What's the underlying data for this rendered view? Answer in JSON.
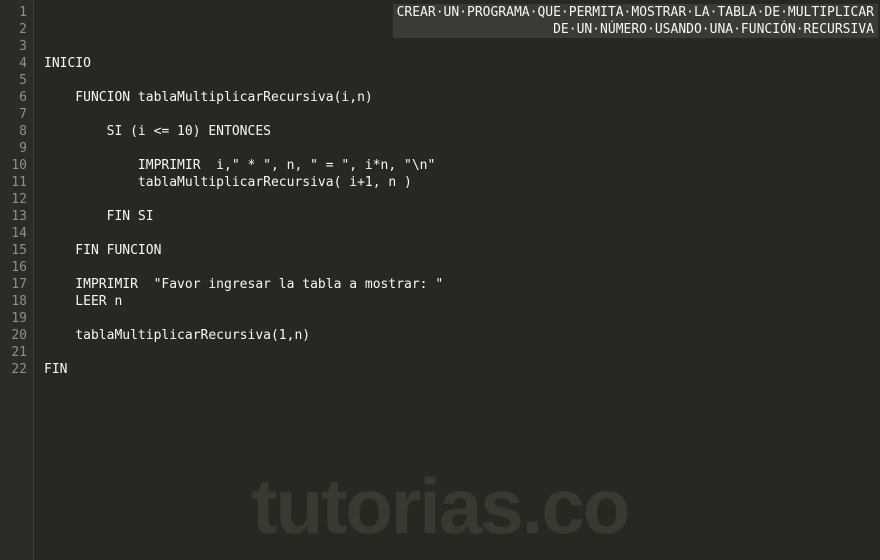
{
  "editor": {
    "gutter_start": 1,
    "gutter_end": 22,
    "header_lines": [
      "CREAR UN PROGRAMA QUE PERMITA MOSTRAR LA TABLA DE MULTIPLICAR",
      "DE UN NÚMERO USANDO UNA FUNCIÓN RECURSIVA"
    ],
    "lines": {
      "3": "",
      "4": "INICIO",
      "5": "",
      "6": "    FUNCION tablaMultiplicarRecursiva(i,n)",
      "7": "",
      "8": "        SI (i <= 10) ENTONCES",
      "9": "",
      "10": "            IMPRIMIR  i,\" * \", n, \" = \", i*n, \"\\n\"",
      "11": "            tablaMultiplicarRecursiva( i+1, n )",
      "12": "",
      "13": "        FIN SI",
      "14": "",
      "15": "    FIN FUNCION",
      "16": "",
      "17": "    IMPRIMIR  \"Favor ingresar la tabla a mostrar: \"",
      "18": "    LEER n",
      "19": "",
      "20": "    tablaMultiplicarRecursiva(1,n)",
      "21": "",
      "22": "FIN"
    }
  },
  "watermark": "tutorias.co"
}
